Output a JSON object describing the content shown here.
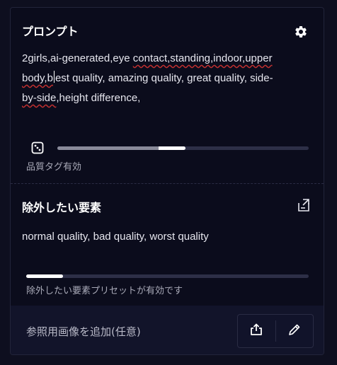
{
  "prompt": {
    "title": "プロンプト",
    "text_line1_a": "2girls,ai-generated,eye ",
    "text_line1_b": "contact,standing,indoor,upper",
    "text_line2_a": "body,b",
    "text_line2_b": "est quality, amazing quality, great quality, side-",
    "text_line3_a": "by-side",
    "text_line3_b": ",height difference,",
    "settings_icon": "gear-icon",
    "dice_icon": "dice-icon",
    "quality_tag_slider_value": 0.51,
    "quality_tag_caption": "品質タグ有効"
  },
  "negative": {
    "title": "除外したい要素",
    "export_icon": "export-icon",
    "text": "normal quality, bad quality, worst quality",
    "preset_slider_value": 0.13,
    "preset_caption": "除外したい要素プリセットが有効です"
  },
  "footer": {
    "ref_label": "参照用画像を追加(任意)",
    "upload_icon": "upload-icon",
    "pen_icon": "pen-icon"
  }
}
